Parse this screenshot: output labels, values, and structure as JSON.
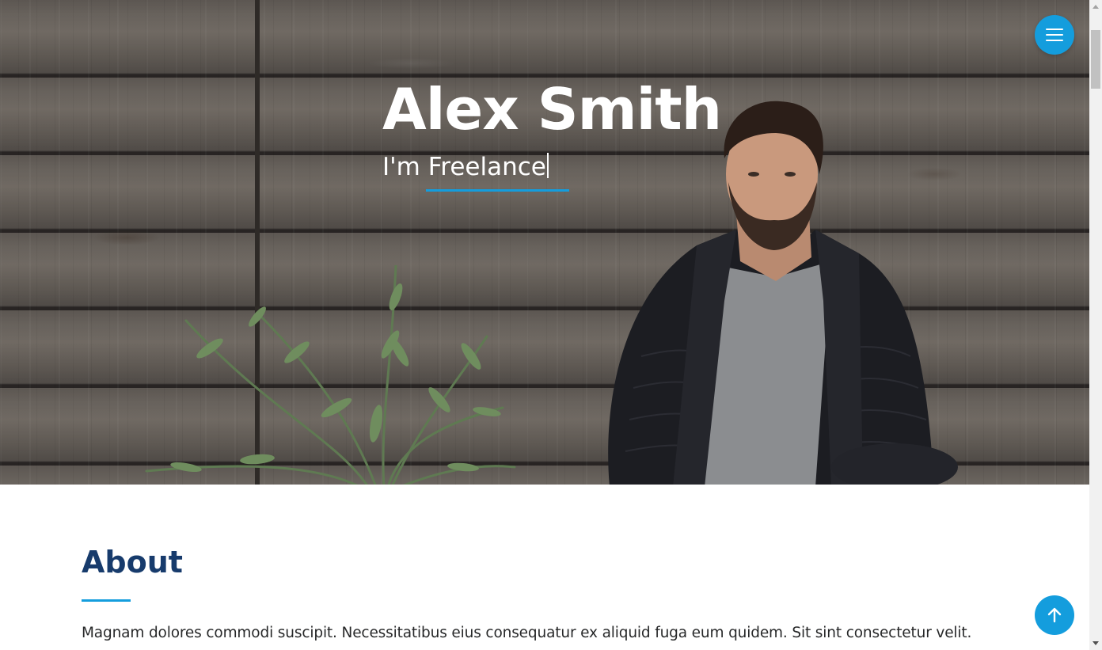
{
  "hero": {
    "name": "Alex Smith",
    "subtitle": "I'm Freelance"
  },
  "nav": {
    "menu_icon": "hamburger-menu-icon"
  },
  "about": {
    "title": "About",
    "text": "Magnam dolores commodi suscipit. Necessitatibus eius consequatur ex aliquid fuga eum quidem. Sit sint consectetur velit."
  },
  "back_to_top": {
    "icon": "arrow-up-icon"
  },
  "colors": {
    "accent": "#149ddd",
    "heading": "#173b6c",
    "text": "#272829"
  }
}
